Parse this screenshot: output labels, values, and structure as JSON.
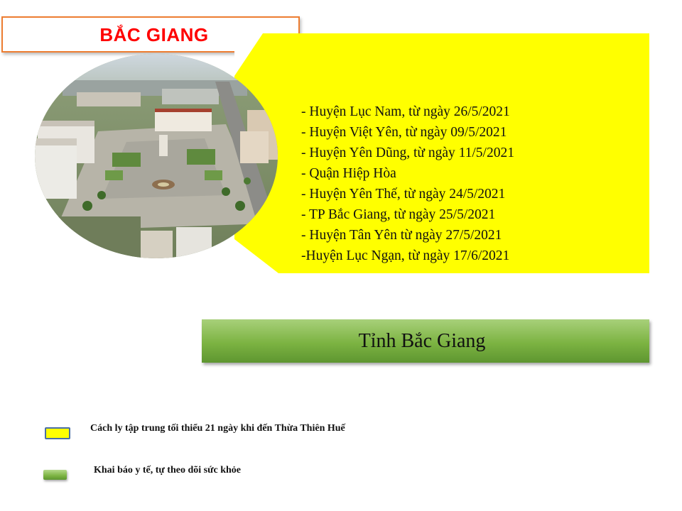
{
  "title": "BẮC GIANG",
  "districts": [
    "- Huyện Lục Nam,  từ ngày 26/5/2021",
    "- Huyện Việt Yên, từ ngày 09/5/2021",
    "- Huyện Yên Dũng, từ ngày 11/5/2021",
    "- Quận Hiệp Hòa",
    "- Huyện Yên Thế, từ ngày 24/5/2021",
    "- TP Bắc Giang, từ ngày 25/5/2021",
    "- Huyện Tân Yên từ ngày 27/5/2021",
    "-Huyện Lục Ngạn,  từ ngày 17/6/2021"
  ],
  "province_label": "Tỉnh Bắc Giang",
  "legend": {
    "yellow": "Cách ly tập trung tối thiểu 21 ngày khi đến Thừa Thiên Huế",
    "green": "Khai báo y tế, tự theo dõi sức khỏe"
  },
  "colors": {
    "title_text": "#ff0000",
    "title_border": "#ed7d31",
    "yellow_panel": "#ffff00",
    "green_panel": "#7cb342"
  }
}
